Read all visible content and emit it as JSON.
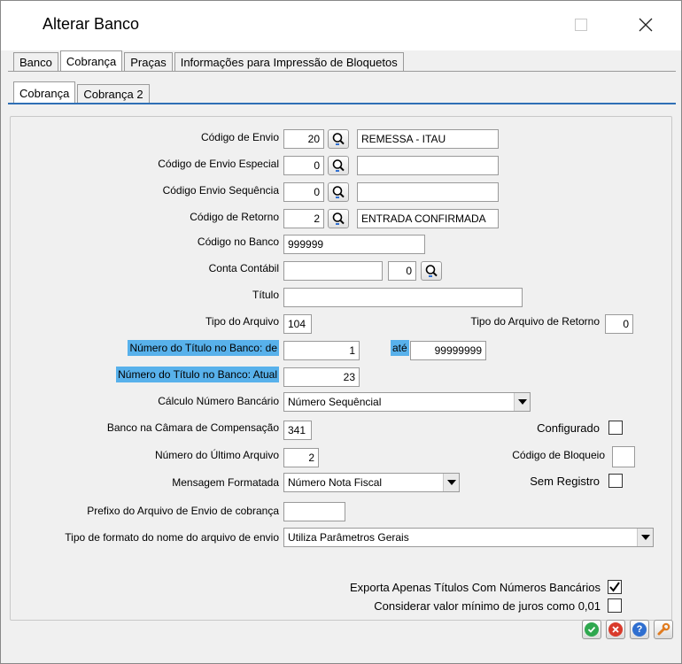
{
  "window": {
    "title": "Alterar Banco"
  },
  "tabs_main": [
    "Banco",
    "Cobrança",
    "Praças",
    "Informações para Impressão de Bloquetos"
  ],
  "tabs_sub": [
    "Cobrança",
    "Cobrança 2"
  ],
  "form": {
    "codigo_envio": {
      "label": "Código de Envio",
      "code": "20",
      "desc": "REMESSA - ITAU"
    },
    "codigo_envio_especial": {
      "label": "Código de Envio Especial",
      "code": "0",
      "desc": ""
    },
    "codigo_envio_sequencia": {
      "label": "Código  Envio Sequência",
      "code": "0",
      "desc": ""
    },
    "codigo_retorno": {
      "label": "Código de Retorno",
      "code": "2",
      "desc": "ENTRADA CONFIRMADA"
    },
    "codigo_banco": {
      "label": "Código no Banco",
      "value": "999999"
    },
    "conta_contabil": {
      "label": "Conta Contábil",
      "value": "",
      "code": "0"
    },
    "titulo": {
      "label": "Título",
      "value": ""
    },
    "tipo_arquivo": {
      "label": "Tipo do Arquivo",
      "value": "104"
    },
    "tipo_arquivo_retorno": {
      "label": "Tipo do Arquivo de Retorno",
      "value": "0"
    },
    "numero_titulo_de": {
      "label": "Número do Título no Banco: de",
      "value": "1"
    },
    "ate": {
      "label": "até",
      "value": "99999999"
    },
    "numero_titulo_atual": {
      "label": "Número do Título no Banco: Atual",
      "value": "23"
    },
    "calculo_numero": {
      "label": "Cálculo Número Bancário",
      "value": "Número Sequêncial"
    },
    "banco_camara": {
      "label": "Banco na Câmara de Compensação",
      "value": "341"
    },
    "configurado": {
      "label": "Configurado",
      "checked": false
    },
    "numero_ultimo_arquivo": {
      "label": "Número do Último Arquivo",
      "value": "2"
    },
    "codigo_bloqueio": {
      "label": "Código de Bloqueio",
      "value": ""
    },
    "mensagem_formatada": {
      "label": "Mensagem Formatada",
      "value": "Número Nota Fiscal"
    },
    "sem_registro": {
      "label": "Sem Registro",
      "checked": false
    },
    "prefixo_arquivo": {
      "label": "Prefixo do Arquivo de Envio de cobrança",
      "value": ""
    },
    "tipo_formato_nome": {
      "label": "Tipo de formato do nome do arquivo de envio",
      "value": "Utiliza Parâmetros Gerais"
    },
    "exporta_apenas": {
      "label": "Exporta Apenas Títulos Com Números Bancários",
      "checked": true
    },
    "considerar_valor": {
      "label": "Considerar valor mínimo de juros como 0,01",
      "checked": false
    }
  },
  "colors": {
    "highlight": "#58b1eb",
    "tab_underline": "#2f6fb5",
    "ok": "#2fa84f",
    "cancel": "#d93a2b",
    "help": "#2f6fd0",
    "settings": "#e07b1f"
  },
  "icons": {
    "lookup": "magnifier-icon",
    "ok": "check-icon",
    "cancel": "x-icon",
    "help": "question-icon",
    "settings": "wrench-icon"
  }
}
